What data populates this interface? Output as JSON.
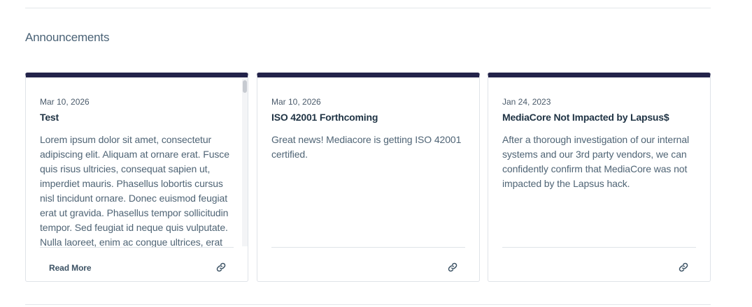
{
  "section": {
    "title": "Announcements"
  },
  "cards": [
    {
      "date": "Mar 10, 2026",
      "title": "Test",
      "text": "Lorem ipsum dolor sit amet, consectetur adipiscing elit. Aliquam at ornare erat. Fusce quis risus ultricies, consequat sapien ut, imperdiet mauris. Phasellus lobortis cursus nisl tincidunt ornare. Donec euismod feugiat erat ut gravida. Phasellus tempor sollicitudin tempor. Sed feugiat id neque quis vulputate. Nulla laoreet, enim ac congue ultrices, erat",
      "read_more": "Read More",
      "link_icon": "link-icon"
    },
    {
      "date": "Mar 10, 2026",
      "title": "ISO 42001 Forthcoming",
      "text": "Great news! Mediacore is getting ISO 42001 certified.",
      "link_icon": "link-icon"
    },
    {
      "date": "Jan 24, 2023",
      "title": "MediaCore Not Impacted by Lapsus$",
      "text": "After a thorough investigation of our internal systems and our 3rd party vendors, we can confidently confirm that MediaCore was not impacted by the Lapsus hack.",
      "link_icon": "link-icon"
    }
  ],
  "colors": {
    "card_accent": "#23234a",
    "title": "#1f3344",
    "body_text": "#4f6475",
    "border": "#dfe3e8"
  }
}
